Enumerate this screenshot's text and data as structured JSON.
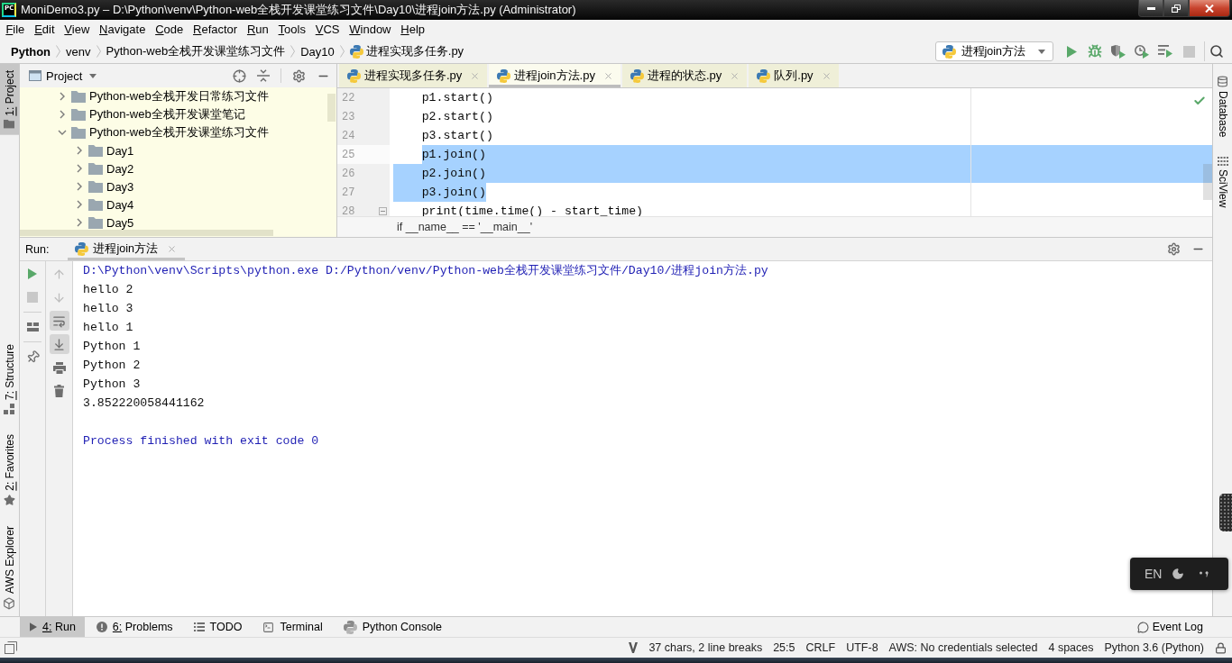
{
  "window": {
    "logo": "PC",
    "title": "MoniDemo3.py – D:\\Python\\venv\\Python-web全栈开发课堂练习文件\\Day10\\进程join方法.py (Administrator)"
  },
  "menu": [
    "File",
    "Edit",
    "View",
    "Navigate",
    "Code",
    "Refactor",
    "Run",
    "Tools",
    "VCS",
    "Window",
    "Help"
  ],
  "breadcrumbs": [
    {
      "label": "Python",
      "kind": "project"
    },
    {
      "label": "venv",
      "kind": "folder"
    },
    {
      "label": "Python-web全栈开发课堂练习文件",
      "kind": "folder"
    },
    {
      "label": "Day10",
      "kind": "folder"
    },
    {
      "label": "进程实现多任务.py",
      "kind": "file"
    }
  ],
  "run_config": {
    "label": "进程join方法"
  },
  "toolbar": [
    {
      "kind": "run",
      "disabled": false
    },
    {
      "kind": "debug",
      "disabled": false
    },
    {
      "kind": "coverage",
      "disabled": false
    },
    {
      "kind": "profile",
      "disabled": false
    },
    {
      "kind": "concurrency",
      "disabled": false
    },
    {
      "kind": "stop",
      "disabled": true
    },
    {
      "kind": "search",
      "disabled": false
    }
  ],
  "left_tools_top": [
    {
      "label": "1: Project",
      "kind": "project",
      "mnemonic": true,
      "selected": true
    }
  ],
  "left_tools_bottom": [
    {
      "label": "7: Structure",
      "kind": "structure",
      "mnemonic": true,
      "selected": false
    },
    {
      "label": "2: Favorites",
      "kind": "favorites",
      "mnemonic": true,
      "selected": false
    },
    {
      "label": "AWS Explorer",
      "kind": "aws",
      "mnemonic": false,
      "selected": false
    }
  ],
  "project": {
    "title": "Project",
    "tree": [
      {
        "label": "Python-web全栈开发日常练习文件",
        "expanded": false
      },
      {
        "label": "Python-web全栈开发课堂笔记",
        "expanded": false
      },
      {
        "label": "Python-web全栈开发课堂练习文件",
        "expanded": true,
        "children": [
          {
            "label": "Day1",
            "expanded": false
          },
          {
            "label": "Day2",
            "expanded": false
          },
          {
            "label": "Day3",
            "expanded": false
          },
          {
            "label": "Day4",
            "expanded": false
          },
          {
            "label": "Day5",
            "expanded": false
          }
        ]
      }
    ]
  },
  "editor": {
    "tabs": [
      {
        "label": "进程实现多任务.py",
        "selected": false
      },
      {
        "label": "进程join方法.py",
        "selected": true
      },
      {
        "label": "进程的状态.py",
        "selected": false
      },
      {
        "label": "队列.py",
        "selected": false
      }
    ],
    "lines": [
      {
        "number": "22",
        "code": "    p1.start()",
        "selected": false,
        "current": false,
        "foldable": false
      },
      {
        "number": "23",
        "code": "    p2.start()",
        "selected": false,
        "current": false,
        "foldable": false
      },
      {
        "number": "24",
        "code": "    p3.start()",
        "selected": false,
        "current": false,
        "foldable": false
      },
      {
        "number": "25",
        "code": "    p1.join()",
        "selected": true,
        "current": true,
        "foldable": false
      },
      {
        "number": "26",
        "code": "    p2.join()",
        "selected": true,
        "current": false,
        "foldable": false
      },
      {
        "number": "27",
        "code": "    p3.join()",
        "selected": true,
        "current": false,
        "foldable": false
      },
      {
        "number": "28",
        "code": "    print(time.time() - start_time)",
        "selected": false,
        "current": false,
        "foldable": true
      }
    ],
    "breadcrumb": "if __name__ == '__main__'"
  },
  "right_tools": [
    {
      "label": "Database",
      "kind": "database",
      "selected": false
    },
    {
      "label": "SciView",
      "kind": "sciview",
      "selected": false
    }
  ],
  "run_panel": {
    "label": "Run:",
    "tabs": [
      {
        "label": "进程join方法",
        "selected": true
      }
    ],
    "tools": [
      {
        "kind": "rerun",
        "disabled": false
      },
      {
        "kind": "stop",
        "disabled": true
      },
      {
        "kind": "layout",
        "disabled": false
      },
      {
        "kind": "pin",
        "disabled": false
      }
    ],
    "tools_2": [
      {
        "kind": "up",
        "disabled": true,
        "on": false
      },
      {
        "kind": "down",
        "disabled": true,
        "on": false
      },
      {
        "kind": "wrap",
        "disabled": false,
        "on": true
      },
      {
        "kind": "scroll_end",
        "disabled": false,
        "on": true
      },
      {
        "kind": "print",
        "disabled": false,
        "on": false
      },
      {
        "kind": "clear",
        "disabled": false,
        "on": false
      }
    ],
    "console": [
      {
        "lines": [
          {
            "text": "D:\\Python\\venv\\Scripts\\python.exe D:/Python/venv/Python-web全栈开发课堂练习文件/Day10/进程join方法.py",
            "kind": "system"
          },
          {
            "text": "hello 2",
            "kind": "output"
          },
          {
            "text": "hello 3",
            "kind": "output"
          },
          {
            "text": "hello 1",
            "kind": "output"
          },
          {
            "text": "Python 1",
            "kind": "output"
          },
          {
            "text": "Python 2",
            "kind": "output"
          },
          {
            "text": "Python 3",
            "kind": "output"
          },
          {
            "text": "3.852220058441162",
            "kind": "output"
          }
        ]
      },
      {
        "lines": [
          {
            "text": "Process finished with exit code 0",
            "kind": "system"
          }
        ]
      }
    ]
  },
  "bottom_tabs": [
    {
      "label": "4: Run",
      "kind": "run",
      "mnemonic": true,
      "selected": true
    },
    {
      "label": "6: Problems",
      "kind": "problems",
      "mnemonic": true,
      "selected": false
    },
    {
      "label": "TODO",
      "kind": "todo",
      "mnemonic": false,
      "selected": false
    },
    {
      "label": "Terminal",
      "kind": "terminal",
      "mnemonic": false,
      "selected": false
    },
    {
      "label": "Python Console",
      "kind": "console",
      "mnemonic": false,
      "selected": false
    }
  ],
  "event_log": "Event Log",
  "status_bar": [
    "37 chars, 2 line breaks",
    "25:5",
    "CRLF",
    "UTF-8",
    "AWS: No credentials selected",
    "4 spaces",
    "Python 3.6 (Python)"
  ],
  "ime": {
    "label": "EN"
  }
}
